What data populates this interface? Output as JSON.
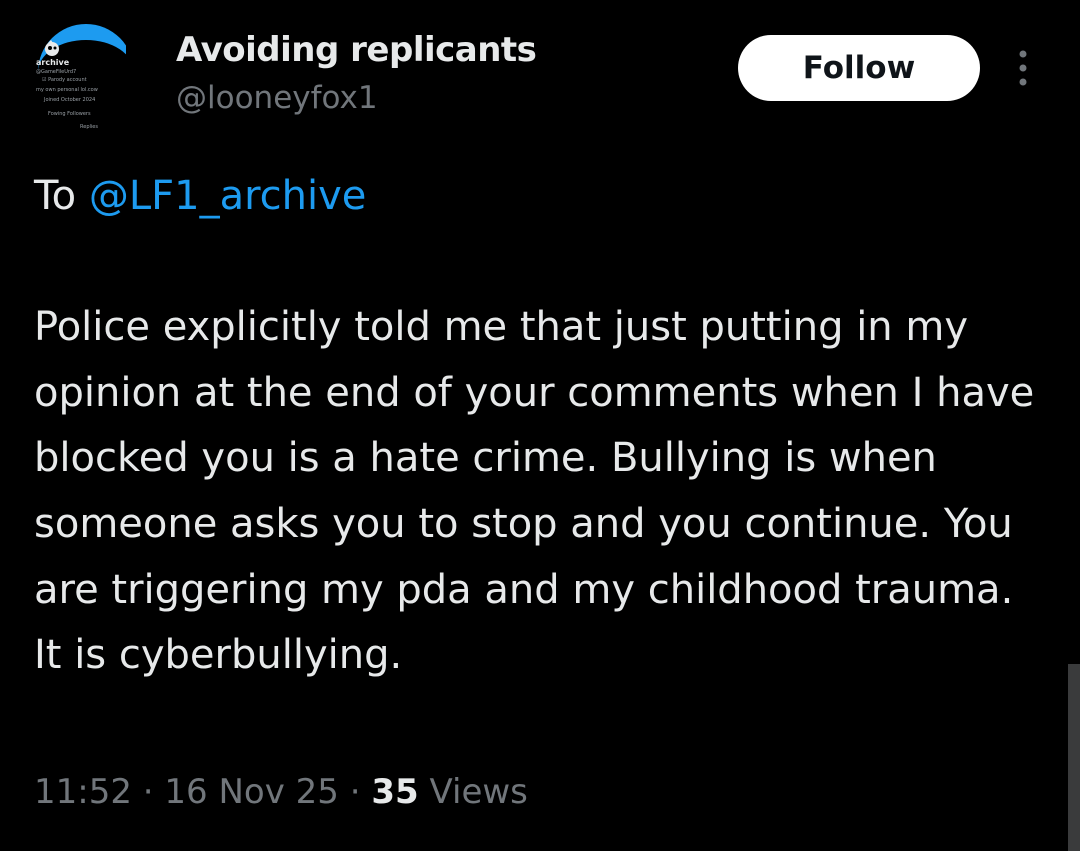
{
  "author": {
    "display_name": "Avoiding replicants",
    "handle": "@looneyfox1",
    "avatar": {
      "icon": "avatar-profile-screenshot",
      "lines": [
        "archive",
        "@GameFileUrd7",
        "☑ Parody account",
        "my own personal lol.cow",
        "Joined October 2024",
        "Fowing  Followers",
        "Replies"
      ]
    }
  },
  "actions": {
    "follow_label": "Follow",
    "more_icon": "more-vertical-icon"
  },
  "tweet": {
    "reply_prefix": "To",
    "reply_to": "@LF1_archive",
    "body": "Police explicitly told me that just putting in my opinion at the end of your comments when I have blocked you is a hate crime.  Bullying is when someone asks you to stop and you continue.  You are triggering my pda and my childhood trauma.  It is cyberbullying."
  },
  "meta": {
    "time": "11:52",
    "separator": "·",
    "date": "16 Nov 25",
    "views_count": "35",
    "views_label": "Views"
  },
  "colors": {
    "background": "#000000",
    "text": "#e7e9ea",
    "secondary_text": "#71767b",
    "accent": "#1d9bf0",
    "button_bg": "#ffffff"
  }
}
